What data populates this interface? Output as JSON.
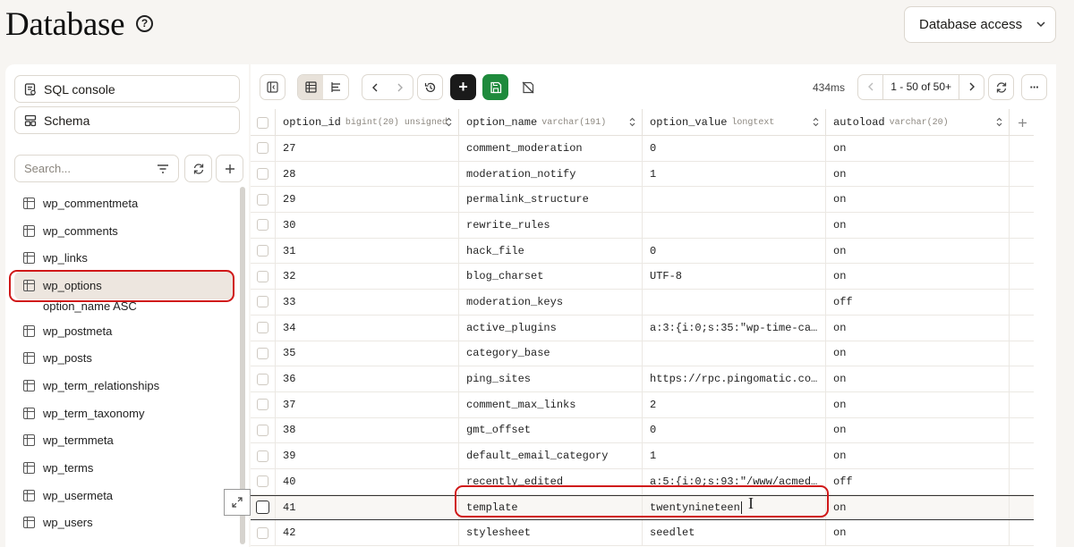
{
  "header": {
    "title": "Database",
    "help": "?",
    "db_access_label": "Database access"
  },
  "sidebar": {
    "sql_console_label": "SQL console",
    "schema_label": "Schema",
    "search_placeholder": "Search...",
    "tables": [
      {
        "name": "wp_commentmeta",
        "selected": false
      },
      {
        "name": "wp_comments",
        "selected": false
      },
      {
        "name": "wp_links",
        "selected": false
      },
      {
        "name": "wp_options",
        "selected": true,
        "sub": "option_name ASC"
      },
      {
        "name": "wp_postmeta",
        "selected": false
      },
      {
        "name": "wp_posts",
        "selected": false
      },
      {
        "name": "wp_term_relationships",
        "selected": false
      },
      {
        "name": "wp_term_taxonomy",
        "selected": false
      },
      {
        "name": "wp_termmeta",
        "selected": false
      },
      {
        "name": "wp_terms",
        "selected": false
      },
      {
        "name": "wp_usermeta",
        "selected": false
      },
      {
        "name": "wp_users",
        "selected": false
      }
    ]
  },
  "toolbar": {
    "timing": "434ms",
    "page_range": "1 - 50 of 50+",
    "add": "+",
    "more": "···"
  },
  "grid": {
    "columns": [
      {
        "name": "option_id",
        "type": "bigint(20) unsigned"
      },
      {
        "name": "option_name",
        "type": "varchar(191)"
      },
      {
        "name": "option_value",
        "type": "longtext"
      },
      {
        "name": "autoload",
        "type": "varchar(20)"
      }
    ],
    "rows": [
      [
        "27",
        "comment_moderation",
        "0",
        "on"
      ],
      [
        "28",
        "moderation_notify",
        "1",
        "on"
      ],
      [
        "29",
        "permalink_structure",
        "",
        "on"
      ],
      [
        "30",
        "rewrite_rules",
        "",
        "on"
      ],
      [
        "31",
        "hack_file",
        "0",
        "on"
      ],
      [
        "32",
        "blog_charset",
        "UTF-8",
        "on"
      ],
      [
        "33",
        "moderation_keys",
        "",
        "off"
      ],
      [
        "34",
        "active_plugins",
        "a:3:{i:0;s:35:\"wp-time-ca…",
        "on"
      ],
      [
        "35",
        "category_base",
        "",
        "on"
      ],
      [
        "36",
        "ping_sites",
        "https://rpc.pingomatic.co…",
        "on"
      ],
      [
        "37",
        "comment_max_links",
        "2",
        "on"
      ],
      [
        "38",
        "gmt_offset",
        "0",
        "on"
      ],
      [
        "39",
        "default_email_category",
        "1",
        "on"
      ],
      [
        "40",
        "recently_edited",
        "a:5:{i:0;s:93:\"/www/acmed…",
        "off"
      ],
      [
        "41",
        "template",
        "twentynineteen",
        "on"
      ],
      [
        "42",
        "stylesheet",
        "seedlet",
        "on"
      ]
    ],
    "active_row_index": 14
  }
}
